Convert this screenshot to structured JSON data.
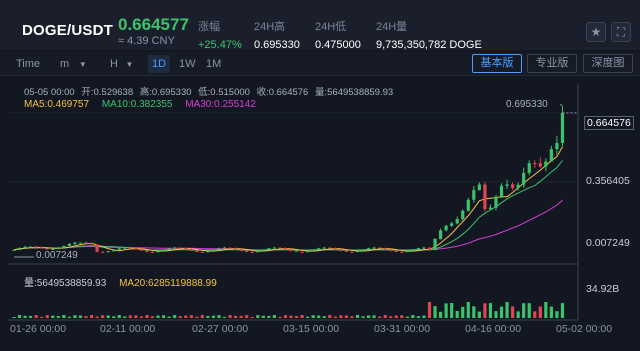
{
  "header": {
    "pair": "DOGE/USDT",
    "price": "0.664577",
    "cny": "≈ 4.39 CNY",
    "stats": [
      {
        "label": "涨幅",
        "value": "+25.47%",
        "up": true
      },
      {
        "label": "24H高",
        "value": "0.695330"
      },
      {
        "label": "24H低",
        "value": "0.475000"
      },
      {
        "label": "24H量",
        "value": "9,735,350,782 DOGE"
      }
    ],
    "star_icon": "star-icon",
    "fullscreen_icon": "fullscreen-icon"
  },
  "toolbar": {
    "time": "Time",
    "minute": "m",
    "hour": "H",
    "day": "1D",
    "week": "1W",
    "month": "1M",
    "views": [
      "基本版",
      "专业版",
      "深度图"
    ],
    "active_view": "基本版"
  },
  "chart": {
    "ohlc": {
      "date": "05-05 00:00",
      "open": "开:0.529638",
      "high": "高:0.695330",
      "low": "低:0.515000",
      "close": "收:0.664576",
      "volume": "量:5649538859.93"
    },
    "ma": [
      {
        "label": "MA5:0.469757",
        "color": "#f5c242"
      },
      {
        "label": "MA10:0.382355",
        "color": "#3bc26b"
      },
      {
        "label": "MA30:0.255142",
        "color": "#d63ed6"
      }
    ],
    "volume_line": [
      {
        "label": "量:5649538859.93",
        "color": "#c7ccd6"
      },
      {
        "label": "MA20:6285119888.99",
        "color": "#f5c242"
      }
    ],
    "y_labels": [
      "0.664576",
      "0.356405",
      "0.007249"
    ],
    "volume_y_label": "34.92B",
    "high_annotation": "0.695330",
    "low_annotation": "0.007249",
    "x_labels": [
      "01-26 00:00",
      "02-11 00:00",
      "02-27 00:00",
      "03-15 00:00",
      "03-31 00:00",
      "04-16 00:00",
      "05-02 00:00"
    ],
    "colors": {
      "up": "#3bc26b",
      "down": "#e0464f",
      "bg": "#131722",
      "grid": "#1e2433"
    }
  },
  "chart_data": {
    "type": "candlestick",
    "symbol": "DOGE/USDT",
    "interval": "1D",
    "x_range": [
      "01-26",
      "05-05"
    ],
    "ylim": [
      0.007249,
      0.69533
    ],
    "y_ticks": [
      0.007249,
      0.356405,
      0.664576
    ],
    "last": {
      "date": "05-05 00:00",
      "open": 0.529638,
      "high": 0.69533,
      "low": 0.515,
      "close": 0.664576,
      "volume": 5649538859.93
    },
    "ma": {
      "MA5": 0.469757,
      "MA10": 0.382355,
      "MA30": 0.255142
    },
    "volume_ma20": 6285119888.99,
    "volume_max_tick": "34.92B"
  }
}
